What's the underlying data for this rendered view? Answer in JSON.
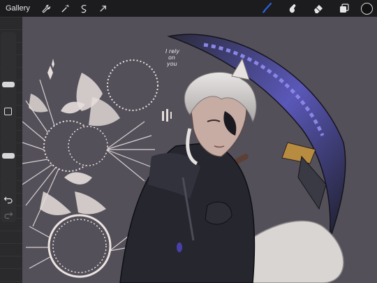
{
  "toolbar": {
    "gallery_label": "Gallery",
    "left_tools": [
      "wrench-icon",
      "magic-wand-icon",
      "selection-icon",
      "transform-arrow-icon"
    ],
    "right_tools": [
      "brush-icon",
      "smudge-icon",
      "eraser-icon",
      "layers-icon"
    ],
    "active_tool": "brush",
    "brush_color": "#2a62d8",
    "current_color": "#111111"
  },
  "sidebar": {
    "brush_size_level": 0.3,
    "opacity_level": 0.53
  },
  "canvas": {
    "background_color": "#54505a",
    "handwritten_text": [
      "I rely",
      "on",
      "you"
    ]
  }
}
